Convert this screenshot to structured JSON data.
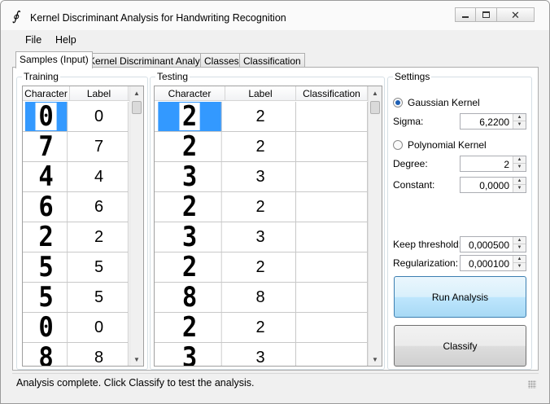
{
  "window": {
    "title": "Kernel Discriminant Analysis for Handwriting Recognition",
    "icon": "integral-icon"
  },
  "menu": [
    "File",
    "Help"
  ],
  "tabs": [
    "Samples (Input)",
    "Kernel Discriminant Analysis",
    "Classes",
    "Classification"
  ],
  "active_tab": "Samples (Input)",
  "training": {
    "group_label": "Training",
    "columns": [
      "Character",
      "Label"
    ],
    "rows": [
      {
        "character": "0",
        "label": "0"
      },
      {
        "character": "7",
        "label": "7"
      },
      {
        "character": "4",
        "label": "4"
      },
      {
        "character": "6",
        "label": "6"
      },
      {
        "character": "2",
        "label": "2"
      },
      {
        "character": "5",
        "label": "5"
      },
      {
        "character": "5",
        "label": "5"
      },
      {
        "character": "0",
        "label": "0"
      },
      {
        "character": "8",
        "label": "8"
      }
    ]
  },
  "testing": {
    "group_label": "Testing",
    "columns": [
      "Character",
      "Label",
      "Classification"
    ],
    "rows": [
      {
        "character": "2",
        "label": "2",
        "classification": ""
      },
      {
        "character": "2",
        "label": "2",
        "classification": ""
      },
      {
        "character": "3",
        "label": "3",
        "classification": ""
      },
      {
        "character": "2",
        "label": "2",
        "classification": ""
      },
      {
        "character": "3",
        "label": "3",
        "classification": ""
      },
      {
        "character": "2",
        "label": "2",
        "classification": ""
      },
      {
        "character": "8",
        "label": "8",
        "classification": ""
      },
      {
        "character": "2",
        "label": "2",
        "classification": ""
      },
      {
        "character": "3",
        "label": "3",
        "classification": ""
      }
    ]
  },
  "settings": {
    "group_label": "Settings",
    "gaussian_label": "Gaussian Kernel",
    "gaussian_selected": true,
    "sigma_label": "Sigma:",
    "sigma_value": "6,2200",
    "polynomial_label": "Polynomial Kernel",
    "polynomial_selected": false,
    "degree_label": "Degree:",
    "degree_value": "2",
    "constant_label": "Constant:",
    "constant_value": "0,0000",
    "threshold_label": "Keep threshold:",
    "threshold_value": "0,000500",
    "regularization_label": "Regularization:",
    "regularization_value": "0,000100"
  },
  "buttons": {
    "run": "Run Analysis",
    "classify": "Classify"
  },
  "status": "Analysis complete. Click Classify to test the analysis.",
  "colors": {
    "selection": "#3399ff",
    "focused_button": "#bee6fd"
  }
}
